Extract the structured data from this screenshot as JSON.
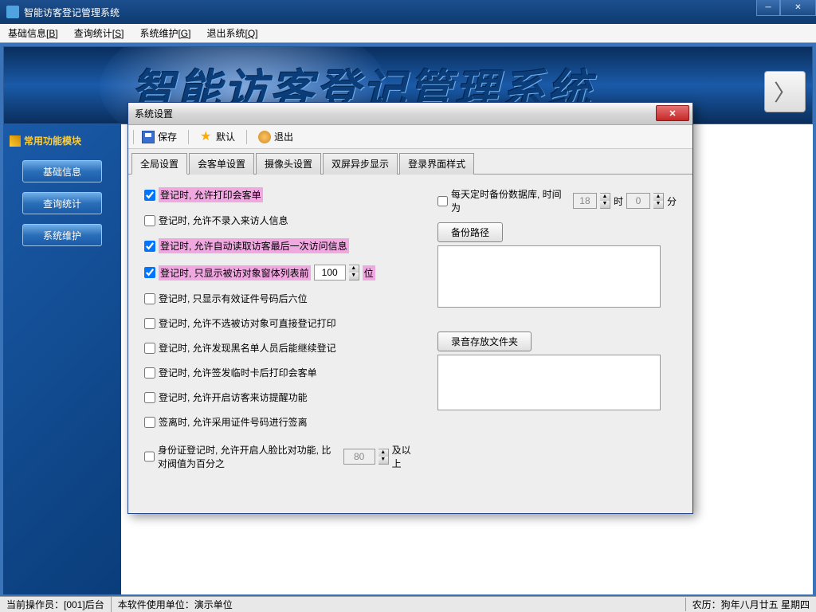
{
  "window": {
    "title": "智能访客登记管理系统"
  },
  "menu": {
    "basic": {
      "text": "基础信息",
      "key": "B"
    },
    "query": {
      "text": "查询统计",
      "key": "S"
    },
    "maint": {
      "text": "系统维护",
      "key": "G"
    },
    "exit": {
      "text": "退出系统",
      "key": "Q"
    }
  },
  "banner": {
    "text": "智能访客登记管理系统"
  },
  "sidebar": {
    "header": "常用功能模块",
    "btn_basic": "基础信息",
    "btn_query": "查询统计",
    "btn_maint": "系统维护"
  },
  "status": {
    "operator_label": "当前操作员：",
    "operator_value": "[001]后台",
    "unit_label": "本软件使用单位：",
    "unit_value": "演示单位",
    "lunar": "农历：狗年八月廿五  星期四"
  },
  "dialog": {
    "title": "系统设置",
    "toolbar": {
      "save": "保存",
      "default": "默认",
      "exit": "退出"
    },
    "tabs": {
      "global": "全局设置",
      "receipt": "会客单设置",
      "camera": "摄像头设置",
      "dual": "双屏异步显示",
      "login": "登录界面样式"
    },
    "checks": {
      "c1": "登记时, 允许打印会客单",
      "c2": "登记时, 允许不录入来访人信息",
      "c3": "登记时, 允许自动读取访客最后一次访问信息",
      "c4a": "登记时, 只显示被访对象窗体列表前",
      "c4b": "位",
      "c4_val": "100",
      "c5": "登记时, 只显示有效证件号码后六位",
      "c6": "登记时, 允许不选被访对象可直接登记打印",
      "c7": "登记时, 允许发现黑名单人员后能继续登记",
      "c8": "登记时, 允许签发临时卡后打印会客单",
      "c9": "登记时, 允许开启访客来访提醒功能",
      "c10": "签离时, 允许采用证件号码进行签离",
      "c11a": "身份证登记时, 允许开启人脸比对功能, 比对阀值为百分之",
      "c11_val": "80",
      "c11b": "及以上"
    },
    "right": {
      "backup_label": "每天定时备份数据库, 时间为",
      "hour_val": "18",
      "hour_unit": "时",
      "min_val": "0",
      "min_unit": "分",
      "backup_path_btn": "备份路径",
      "record_folder_btn": "录音存放文件夹"
    }
  }
}
